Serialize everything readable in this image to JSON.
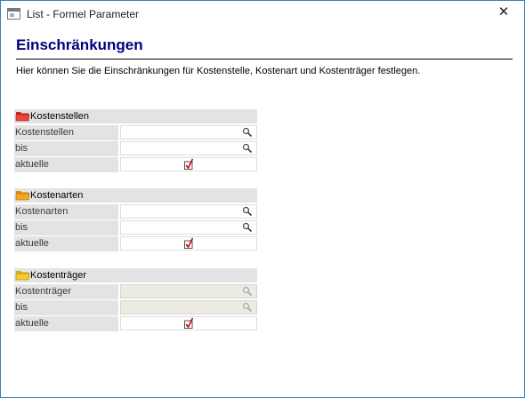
{
  "window": {
    "title": "List - Formel Parameter",
    "close_glyph": "✕"
  },
  "page": {
    "heading": "Einschränkungen",
    "description": "Hier können Sie die Einschränkungen für Kostenstelle, Kostenart und Kostenträger festlegen."
  },
  "sections": [
    {
      "title": "Kostenstellen",
      "folder_color": "#e8463c",
      "rows": [
        {
          "label": "Kostenstellen",
          "value": "",
          "type": "lookup",
          "disabled": false
        },
        {
          "label": "bis",
          "value": "",
          "type": "lookup",
          "disabled": false
        },
        {
          "label": "aktuelle",
          "checked": true,
          "type": "checkbox"
        }
      ]
    },
    {
      "title": "Kostenarten",
      "folder_color": "#f5a623",
      "rows": [
        {
          "label": "Kostenarten",
          "value": "",
          "type": "lookup",
          "disabled": false
        },
        {
          "label": "bis",
          "value": "",
          "type": "lookup",
          "disabled": false
        },
        {
          "label": "aktuelle",
          "checked": true,
          "type": "checkbox"
        }
      ]
    },
    {
      "title": "Kostenträger",
      "folder_color": "#f7c92c",
      "rows": [
        {
          "label": "Kostenträger",
          "value": "",
          "type": "lookup",
          "disabled": true
        },
        {
          "label": "bis",
          "value": "",
          "type": "lookup",
          "disabled": true
        },
        {
          "label": "aktuelle",
          "checked": true,
          "type": "checkbox"
        }
      ]
    }
  ],
  "icons": {
    "lookup": "magnifier-icon",
    "checkbox": "checkmark-icon",
    "folder": "folder-icon",
    "close": "close-icon"
  }
}
